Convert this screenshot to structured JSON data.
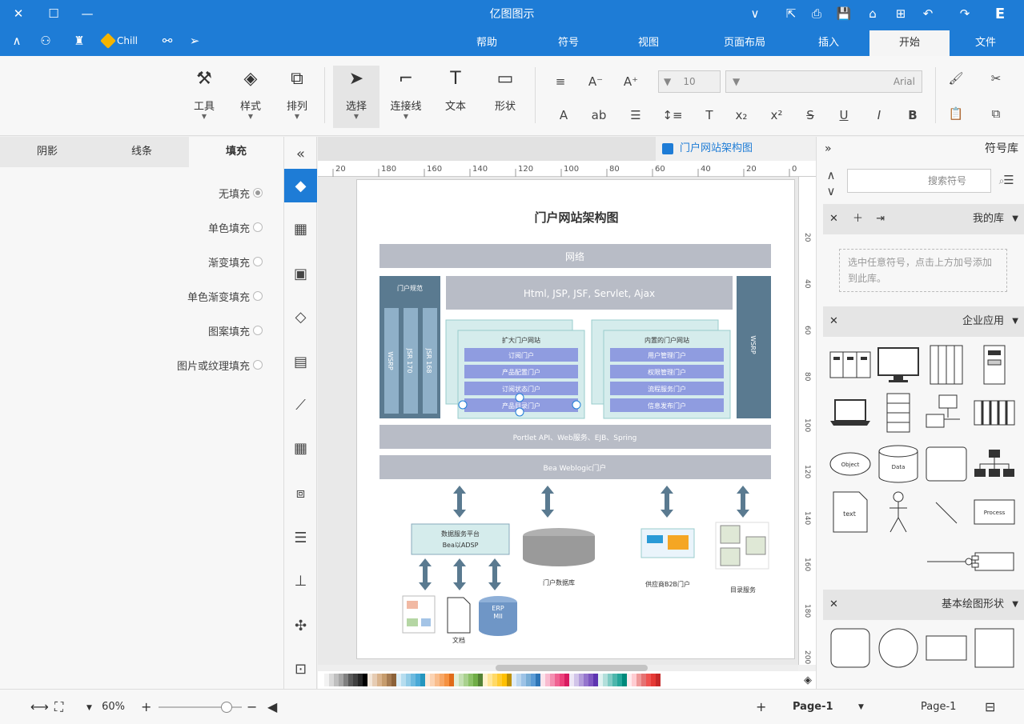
{
  "app": {
    "title": "亿图图示",
    "user": "Chill"
  },
  "ribbon_tabs": [
    "文件",
    "开始",
    "插入",
    "页面布局",
    "视图",
    "符号",
    "帮助"
  ],
  "active_ribbon_tab": "开始",
  "toolbar": {
    "tools": [
      "形状",
      "文本",
      "连接线",
      "选择",
      "排列",
      "样式",
      "工具"
    ],
    "font_name": "Arial",
    "font_size": "10",
    "format_buttons": [
      "B",
      "I",
      "U",
      "S",
      "x²",
      "x₂",
      "T",
      "ab",
      "A",
      "A"
    ]
  },
  "left_panel": {
    "tabs": [
      "填充",
      "线条",
      "阴影"
    ],
    "active_tab": "填充",
    "fill_options": [
      "无填充",
      "单色填充",
      "渐变填充",
      "单色渐变填充",
      "图案填充",
      "图片或纹理填充"
    ],
    "selected_fill": "无填充"
  },
  "doc": {
    "tab_name": "门户网站架构图",
    "ruler_h": [
      "0",
      "20",
      "40",
      "60",
      "80",
      "100",
      "120",
      "140",
      "160",
      "180",
      "20"
    ],
    "ruler_v": [
      "20",
      "40",
      "60",
      "80",
      "100",
      "120",
      "140",
      "160",
      "180",
      "200"
    ]
  },
  "diagram": {
    "title": "门户网站架构图",
    "network": "网络",
    "tech_bar": "Html, JSP, JSF, Servlet, Ajax",
    "portal_spec": "门户规范",
    "jsr_bars": [
      "JSR 168",
      "JSR 170",
      "WSRP"
    ],
    "wsrp_right": "WSRP",
    "group_left_title": "扩大门户网站",
    "group_left_items": [
      "订阅门户",
      "产品配置门户",
      "订阅状态门户",
      "产品目录门户"
    ],
    "group_right_title": "内置的门户网站",
    "group_right_items": [
      "用户管理门户",
      "权限管理门户",
      "流程服务门户",
      "信息发布门户"
    ],
    "portlet_bar": "Portlet API、Web服务、EJB、Spring",
    "bea_bar": "Bea Weblogic门户",
    "platform_box": [
      "数据服务平台",
      "Bea以ADSP"
    ],
    "doc_label": "文档",
    "db_label": "ERP\nMII",
    "portal_db": "门户数据库",
    "b2b": "供应商B2B门户",
    "dir_service": "目录服务"
  },
  "right_panel": {
    "title": "符号库",
    "search_placeholder": "搜索符号",
    "sections": [
      "我的库",
      "企业应用",
      "基本绘图形状"
    ],
    "my_lib_hint": "选中任意符号，点击上方加号添加到此库。",
    "shape_labels": [
      "Object",
      "Data",
      "text",
      "Process"
    ]
  },
  "statusbar": {
    "page_selector": "Page-1",
    "current_page": "Page-1",
    "zoom": "60%"
  },
  "colors": {
    "brand": "#1e7cd6",
    "bar_gray": "#b8bcc6",
    "dark_slate": "#5a7a90",
    "light_teal": "#d5ecec",
    "purple_item": "#8f9ce0"
  }
}
